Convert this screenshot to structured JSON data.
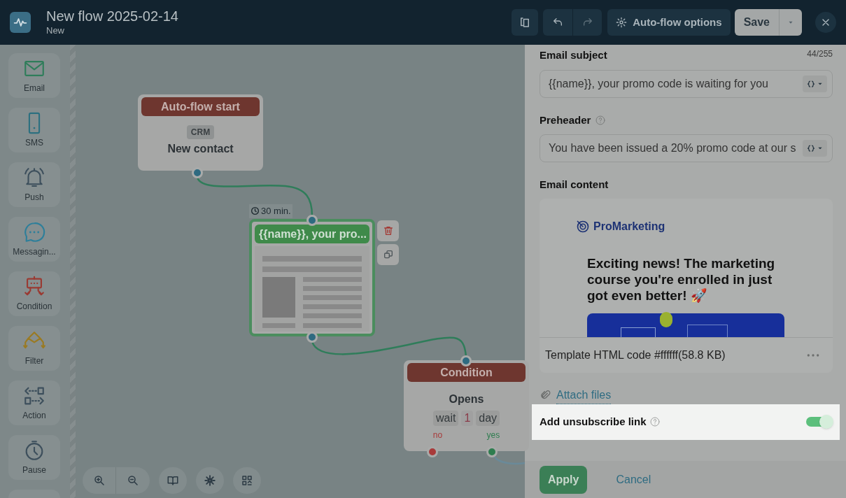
{
  "header": {
    "title": "New flow 2025-02-14",
    "subtitle": "New",
    "options_button": "Auto-flow options",
    "save_button": "Save"
  },
  "palette": [
    {
      "kind": "email",
      "label": "Email"
    },
    {
      "kind": "sms",
      "label": "SMS"
    },
    {
      "kind": "push",
      "label": "Push"
    },
    {
      "kind": "messaging",
      "label": "Messagin..."
    },
    {
      "kind": "condition",
      "label": "Condition"
    },
    {
      "kind": "filter",
      "label": "Filter"
    },
    {
      "kind": "action",
      "label": "Action"
    },
    {
      "kind": "pause",
      "label": "Pause"
    }
  ],
  "canvas": {
    "start_node": {
      "header": "Auto-flow start",
      "tag": "CRM",
      "title": "New contact"
    },
    "email_node": {
      "delay": "30 min.",
      "header": "{{name}}, your pro...",
      "selected": true
    },
    "condition_node": {
      "header": "Condition",
      "title": "Opens",
      "wait": [
        "wait",
        "1",
        "day"
      ],
      "outputs": [
        {
          "label": "no",
          "color": "#a83a3a"
        },
        {
          "label": "yes",
          "color": "#2e7d4f"
        }
      ]
    }
  },
  "panel": {
    "subject": {
      "label": "Email subject",
      "counter": "44/255",
      "value": "{{name}}, your promo code is waiting for you"
    },
    "preheader": {
      "label": "Preheader",
      "value": "You have been issued a 20% promo code at our s"
    },
    "content": {
      "label": "Email content",
      "brand": "ProMarketing",
      "headline": "Exciting news! The marketing course you're enrolled in just got even better! 🚀",
      "file": "Template HTML code #ffffff(58.8 KB)"
    },
    "attach": "Attach files",
    "unsubscribe": {
      "label": "Add unsubscribe link",
      "on": true
    },
    "apply": "Apply",
    "cancel": "Cancel"
  }
}
